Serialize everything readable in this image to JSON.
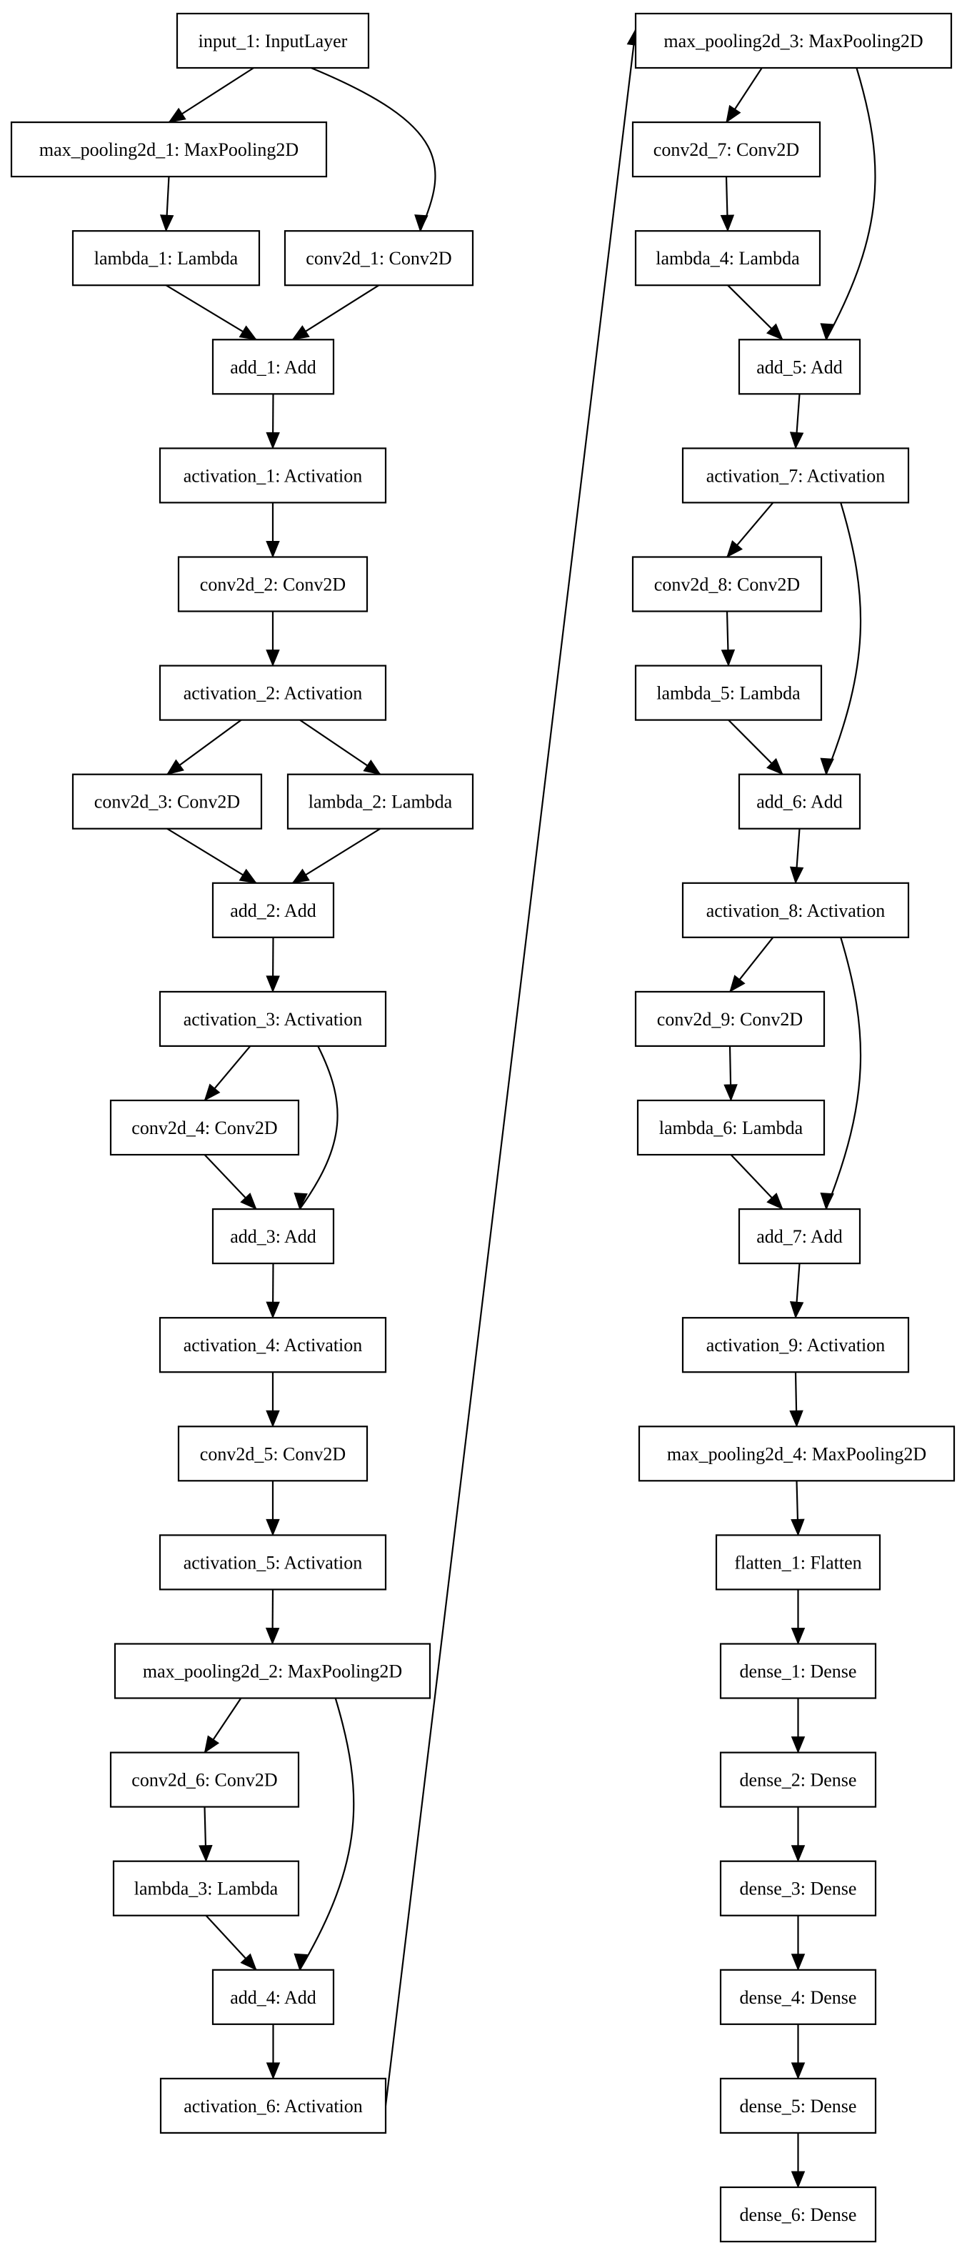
{
  "diagram": {
    "type": "keras-model-plot",
    "nodes": [
      {
        "id": "input_1",
        "label": "input_1: InputLayer"
      },
      {
        "id": "max_pooling2d_1",
        "label": "max_pooling2d_1: MaxPooling2D"
      },
      {
        "id": "lambda_1",
        "label": "lambda_1: Lambda"
      },
      {
        "id": "conv2d_1",
        "label": "conv2d_1: Conv2D"
      },
      {
        "id": "add_1",
        "label": "add_1: Add"
      },
      {
        "id": "activation_1",
        "label": "activation_1: Activation"
      },
      {
        "id": "conv2d_2",
        "label": "conv2d_2: Conv2D"
      },
      {
        "id": "activation_2",
        "label": "activation_2: Activation"
      },
      {
        "id": "conv2d_3",
        "label": "conv2d_3: Conv2D"
      },
      {
        "id": "lambda_2",
        "label": "lambda_2: Lambda"
      },
      {
        "id": "add_2",
        "label": "add_2: Add"
      },
      {
        "id": "activation_3",
        "label": "activation_3: Activation"
      },
      {
        "id": "conv2d_4",
        "label": "conv2d_4: Conv2D"
      },
      {
        "id": "add_3",
        "label": "add_3: Add"
      },
      {
        "id": "activation_4",
        "label": "activation_4: Activation"
      },
      {
        "id": "conv2d_5",
        "label": "conv2d_5: Conv2D"
      },
      {
        "id": "activation_5",
        "label": "activation_5: Activation"
      },
      {
        "id": "max_pooling2d_2",
        "label": "max_pooling2d_2: MaxPooling2D"
      },
      {
        "id": "conv2d_6",
        "label": "conv2d_6: Conv2D"
      },
      {
        "id": "lambda_3",
        "label": "lambda_3: Lambda"
      },
      {
        "id": "add_4",
        "label": "add_4: Add"
      },
      {
        "id": "activation_6",
        "label": "activation_6: Activation"
      },
      {
        "id": "max_pooling2d_3",
        "label": "max_pooling2d_3: MaxPooling2D"
      },
      {
        "id": "conv2d_7",
        "label": "conv2d_7: Conv2D"
      },
      {
        "id": "lambda_4",
        "label": "lambda_4: Lambda"
      },
      {
        "id": "add_5",
        "label": "add_5: Add"
      },
      {
        "id": "activation_7",
        "label": "activation_7: Activation"
      },
      {
        "id": "conv2d_8",
        "label": "conv2d_8: Conv2D"
      },
      {
        "id": "lambda_5",
        "label": "lambda_5: Lambda"
      },
      {
        "id": "add_6",
        "label": "add_6: Add"
      },
      {
        "id": "activation_8",
        "label": "activation_8: Activation"
      },
      {
        "id": "conv2d_9",
        "label": "conv2d_9: Conv2D"
      },
      {
        "id": "lambda_6",
        "label": "lambda_6: Lambda"
      },
      {
        "id": "add_7",
        "label": "add_7: Add"
      },
      {
        "id": "activation_9",
        "label": "activation_9: Activation"
      },
      {
        "id": "max_pooling2d_4",
        "label": "max_pooling2d_4: MaxPooling2D"
      },
      {
        "id": "flatten_1",
        "label": "flatten_1: Flatten"
      },
      {
        "id": "dense_1",
        "label": "dense_1: Dense"
      },
      {
        "id": "dense_2",
        "label": "dense_2: Dense"
      },
      {
        "id": "dense_3",
        "label": "dense_3: Dense"
      },
      {
        "id": "dense_4",
        "label": "dense_4: Dense"
      },
      {
        "id": "dense_5",
        "label": "dense_5: Dense"
      },
      {
        "id": "dense_6",
        "label": "dense_6: Dense"
      }
    ],
    "edges": [
      [
        "input_1",
        "max_pooling2d_1"
      ],
      [
        "input_1",
        "conv2d_1"
      ],
      [
        "max_pooling2d_1",
        "lambda_1"
      ],
      [
        "lambda_1",
        "add_1"
      ],
      [
        "conv2d_1",
        "add_1"
      ],
      [
        "add_1",
        "activation_1"
      ],
      [
        "activation_1",
        "conv2d_2"
      ],
      [
        "conv2d_2",
        "activation_2"
      ],
      [
        "activation_2",
        "conv2d_3"
      ],
      [
        "activation_2",
        "lambda_2"
      ],
      [
        "conv2d_3",
        "add_2"
      ],
      [
        "lambda_2",
        "add_2"
      ],
      [
        "add_2",
        "activation_3"
      ],
      [
        "activation_3",
        "conv2d_4"
      ],
      [
        "activation_3",
        "add_3"
      ],
      [
        "conv2d_4",
        "add_3"
      ],
      [
        "add_3",
        "activation_4"
      ],
      [
        "activation_4",
        "conv2d_5"
      ],
      [
        "conv2d_5",
        "activation_5"
      ],
      [
        "activation_5",
        "max_pooling2d_2"
      ],
      [
        "max_pooling2d_2",
        "conv2d_6"
      ],
      [
        "max_pooling2d_2",
        "add_4"
      ],
      [
        "conv2d_6",
        "lambda_3"
      ],
      [
        "lambda_3",
        "add_4"
      ],
      [
        "add_4",
        "activation_6"
      ],
      [
        "activation_6",
        "max_pooling2d_3"
      ],
      [
        "max_pooling2d_3",
        "conv2d_7"
      ],
      [
        "max_pooling2d_3",
        "add_5"
      ],
      [
        "conv2d_7",
        "lambda_4"
      ],
      [
        "lambda_4",
        "add_5"
      ],
      [
        "add_5",
        "activation_7"
      ],
      [
        "activation_7",
        "conv2d_8"
      ],
      [
        "activation_7",
        "add_6"
      ],
      [
        "conv2d_8",
        "lambda_5"
      ],
      [
        "lambda_5",
        "add_6"
      ],
      [
        "add_6",
        "activation_8"
      ],
      [
        "activation_8",
        "conv2d_9"
      ],
      [
        "activation_8",
        "add_7"
      ],
      [
        "conv2d_9",
        "lambda_6"
      ],
      [
        "lambda_6",
        "add_7"
      ],
      [
        "add_7",
        "activation_9"
      ],
      [
        "activation_9",
        "max_pooling2d_4"
      ],
      [
        "max_pooling2d_4",
        "flatten_1"
      ],
      [
        "flatten_1",
        "dense_1"
      ],
      [
        "dense_1",
        "dense_2"
      ],
      [
        "dense_2",
        "dense_3"
      ],
      [
        "dense_3",
        "dense_4"
      ],
      [
        "dense_4",
        "dense_5"
      ],
      [
        "dense_5",
        "dense_6"
      ]
    ]
  }
}
